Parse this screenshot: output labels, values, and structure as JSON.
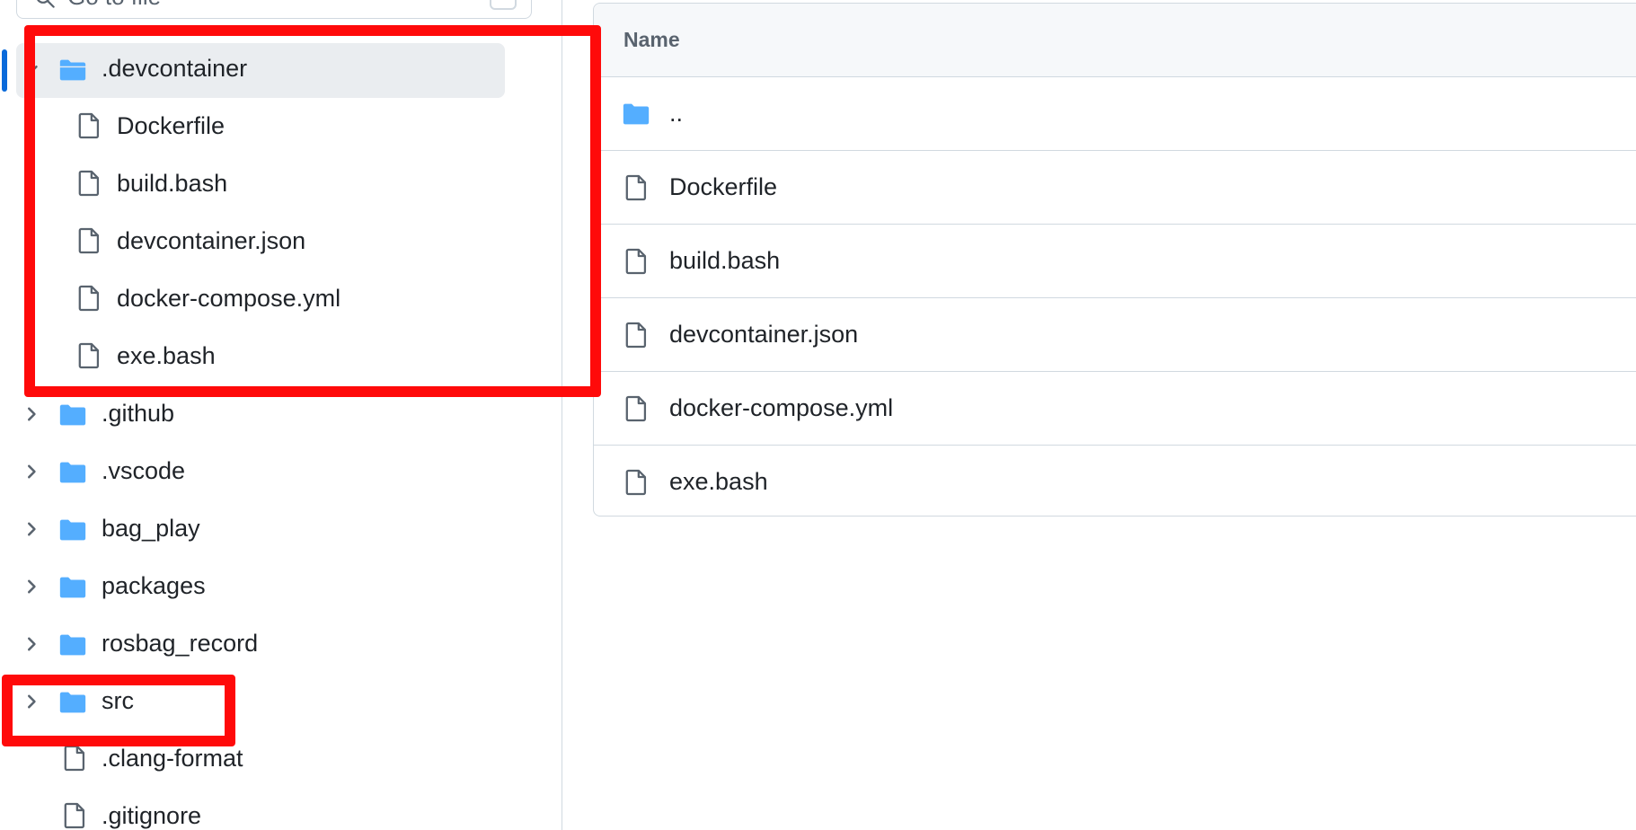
{
  "search": {
    "placeholder": "Go to file"
  },
  "tree": [
    {
      "label": ".devcontainer",
      "type": "folder",
      "level": 0,
      "expanded": true,
      "selected": true,
      "icon": "folder-open-icon"
    },
    {
      "label": "Dockerfile",
      "type": "file",
      "level": 1,
      "icon": "file-icon"
    },
    {
      "label": "build.bash",
      "type": "file",
      "level": 1,
      "icon": "file-icon"
    },
    {
      "label": "devcontainer.json",
      "type": "file",
      "level": 1,
      "icon": "file-icon"
    },
    {
      "label": "docker-compose.yml",
      "type": "file",
      "level": 1,
      "icon": "file-icon"
    },
    {
      "label": "exe.bash",
      "type": "file",
      "level": 1,
      "icon": "file-icon"
    },
    {
      "label": ".github",
      "type": "folder",
      "level": 0,
      "expanded": false,
      "icon": "folder-icon"
    },
    {
      "label": ".vscode",
      "type": "folder",
      "level": 0,
      "expanded": false,
      "icon": "folder-icon"
    },
    {
      "label": "bag_play",
      "type": "folder",
      "level": 0,
      "expanded": false,
      "icon": "folder-icon"
    },
    {
      "label": "packages",
      "type": "folder",
      "level": 0,
      "expanded": false,
      "icon": "folder-icon"
    },
    {
      "label": "rosbag_record",
      "type": "folder",
      "level": 0,
      "expanded": false,
      "icon": "folder-icon"
    },
    {
      "label": "src",
      "type": "folder",
      "level": 0,
      "expanded": false,
      "icon": "folder-icon"
    },
    {
      "label": ".clang-format",
      "type": "file",
      "level": 0,
      "icon": "file-icon"
    },
    {
      "label": ".gitignore",
      "type": "file",
      "level": 0,
      "icon": "file-icon"
    }
  ],
  "main": {
    "header": {
      "name": "Name"
    },
    "rows": [
      {
        "label": "..",
        "type": "folder",
        "icon": "folder-icon"
      },
      {
        "label": "Dockerfile",
        "type": "file",
        "icon": "file-icon"
      },
      {
        "label": "build.bash",
        "type": "file",
        "icon": "file-icon"
      },
      {
        "label": "devcontainer.json",
        "type": "file",
        "icon": "file-icon"
      },
      {
        "label": "docker-compose.yml",
        "type": "file",
        "icon": "file-icon"
      },
      {
        "label": "exe.bash",
        "type": "file",
        "icon": "file-icon"
      }
    ]
  },
  "colors": {
    "folder": "#54aeff",
    "file_stroke": "#59636e",
    "selected_bg": "#eaedf0",
    "accent": "#0969da",
    "annotation": "#ff0a0a"
  }
}
